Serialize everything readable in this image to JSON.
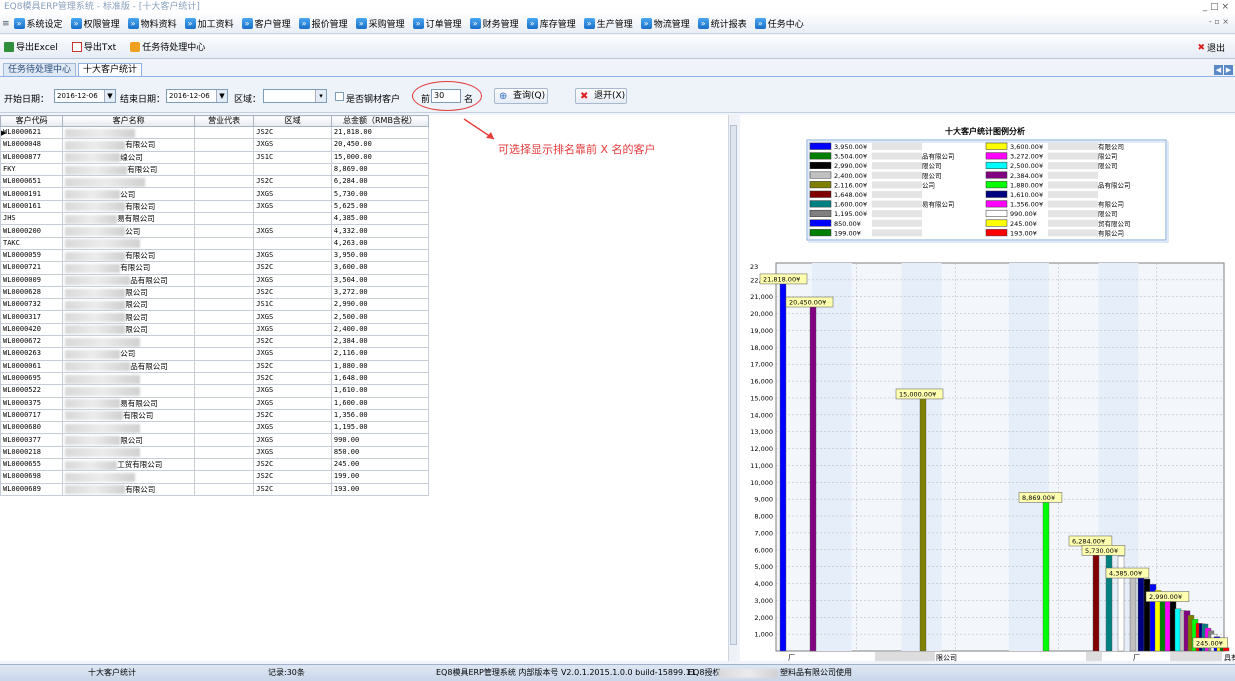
{
  "window": {
    "title": "EQ8模具ERP管理系统 - 标准版 - [十大客户统计]",
    "controls": "_ □ ×"
  },
  "menu": {
    "items": [
      {
        "label": "系统设定"
      },
      {
        "label": "权限管理"
      },
      {
        "label": "物料资料"
      },
      {
        "label": "加工资料"
      },
      {
        "label": "客户管理"
      },
      {
        "label": "报价管理"
      },
      {
        "label": "采购管理"
      },
      {
        "label": "订单管理"
      },
      {
        "label": "财务管理"
      },
      {
        "label": "库存管理"
      },
      {
        "label": "生产管理"
      },
      {
        "label": "物流管理"
      },
      {
        "label": "统计报表"
      },
      {
        "label": "任务中心"
      }
    ],
    "mdi_controls": "- ▫ ×"
  },
  "toolbar": {
    "export_excel": "导出Excel",
    "export_txt": "导出Txt",
    "task_center": "任务待处理中心",
    "exit": "退出"
  },
  "tabs": [
    {
      "label": "任务待处理中心"
    },
    {
      "label": "十大客户统计"
    }
  ],
  "filter": {
    "start_label": "开始日期：",
    "start_value": "2016-12-06",
    "end_label": "结束日期：",
    "end_value": "2016-12-06",
    "region_label": "区域：",
    "region_value": "",
    "steel_label": "是否钢材客户",
    "top_prefix": "前",
    "top_value": "30",
    "top_suffix": "名",
    "query_button": "查询(Q)",
    "exit_button": "退开(X)"
  },
  "annotation": "可选择显示排名靠前 X 名的客户",
  "grid": {
    "columns": [
      "客户代码",
      "客户名称",
      "营业代表",
      "区域",
      "总金额（RMB含税）"
    ],
    "rows": [
      {
        "code": "WL0000621",
        "name": "",
        "rep": "",
        "region": "JS2C",
        "amount": "21,818.00"
      },
      {
        "code": "WL0000048",
        "name": "有限公司",
        "rep": "",
        "region": "JXGS",
        "amount": "20,450.00"
      },
      {
        "code": "WL0000877",
        "name": "缐公司",
        "rep": "",
        "region": "JS1C",
        "amount": "15,000.00"
      },
      {
        "code": "FKY",
        "name": "有限公司",
        "rep": "",
        "region": "",
        "amount": "8,869.00"
      },
      {
        "code": "WL0000651",
        "name": "",
        "rep": "",
        "region": "JS2C",
        "amount": "6,284.00"
      },
      {
        "code": "WL0000191",
        "name": "公司",
        "rep": "",
        "region": "JXGS",
        "amount": "5,730.00"
      },
      {
        "code": "WL0000161",
        "name": "有限公司",
        "rep": "",
        "region": "JXGS",
        "amount": "5,625.00"
      },
      {
        "code": "JHS",
        "name": "易有限公司",
        "rep": "",
        "region": "",
        "amount": "4,385.00"
      },
      {
        "code": "WL0000200",
        "name": "公司",
        "rep": "",
        "region": "JXGS",
        "amount": "4,332.00"
      },
      {
        "code": "TAKC",
        "name": "",
        "rep": "",
        "region": "",
        "amount": "4,263.00"
      },
      {
        "code": "WL0000059",
        "name": "有限公司",
        "rep": "",
        "region": "JXGS",
        "amount": "3,950.00"
      },
      {
        "code": "WL0000721",
        "name": "有限公司",
        "rep": "",
        "region": "JS2C",
        "amount": "3,600.00"
      },
      {
        "code": "WL0000009",
        "name": "品有限公司",
        "rep": "",
        "region": "JXGS",
        "amount": "3,504.00"
      },
      {
        "code": "WL0000628",
        "name": "限公司",
        "rep": "",
        "region": "JS2C",
        "amount": "3,272.00"
      },
      {
        "code": "WL0000732",
        "name": "限公司",
        "rep": "",
        "region": "JS1C",
        "amount": "2,990.00"
      },
      {
        "code": "WL0000317",
        "name": "限公司",
        "rep": "",
        "region": "JXGS",
        "amount": "2,500.00"
      },
      {
        "code": "WL0000420",
        "name": "限公司",
        "rep": "",
        "region": "JXGS",
        "amount": "2,400.00"
      },
      {
        "code": "WL0000672",
        "name": "",
        "rep": "",
        "region": "JS2C",
        "amount": "2,384.00"
      },
      {
        "code": "WL0000263",
        "name": "公司",
        "rep": "",
        "region": "JXGS",
        "amount": "2,116.00"
      },
      {
        "code": "WL0000061",
        "name": "品有限公司",
        "rep": "",
        "region": "JS2C",
        "amount": "1,880.00"
      },
      {
        "code": "WL0000695",
        "name": "",
        "rep": "",
        "region": "JS2C",
        "amount": "1,648.00"
      },
      {
        "code": "WL0000522",
        "name": "",
        "rep": "",
        "region": "JXGS",
        "amount": "1,610.00"
      },
      {
        "code": "WL0000375",
        "name": "易有限公司",
        "rep": "",
        "region": "JXGS",
        "amount": "1,600.00"
      },
      {
        "code": "WL0000717",
        "name": "有限公司",
        "rep": "",
        "region": "JS2C",
        "amount": "1,356.00"
      },
      {
        "code": "WL0000680",
        "name": "",
        "rep": "",
        "region": "JXGS",
        "amount": "1,195.00"
      },
      {
        "code": "WL0000377",
        "name": "限公司",
        "rep": "",
        "region": "JXGS",
        "amount": "990.00"
      },
      {
        "code": "WL0000218",
        "name": "",
        "rep": "",
        "region": "JXGS",
        "amount": "850.00"
      },
      {
        "code": "WL0000655",
        "name": "工贸有限公司",
        "rep": "",
        "region": "JS2C",
        "amount": "245.00"
      },
      {
        "code": "WL0000698",
        "name": "",
        "rep": "",
        "region": "JS2C",
        "amount": "199.00"
      },
      {
        "code": "WL0000689",
        "name": "有限公司",
        "rep": "",
        "region": "JS2C",
        "amount": "193.00"
      }
    ]
  },
  "chart_data": {
    "type": "bar",
    "title": "十大客户统计图例分析",
    "ylim": [
      0,
      23000
    ],
    "yticks": [
      1000,
      2000,
      3000,
      4000,
      5000,
      6000,
      7000,
      8000,
      9000,
      10000,
      11000,
      12000,
      13000,
      14000,
      15000,
      16000,
      17000,
      18000,
      19000,
      20000,
      21000,
      22000
    ],
    "ytick_labels": [
      "1,000",
      "2,000",
      "3,000",
      "4,000",
      "5,000",
      "6,000",
      "7,000",
      "8,000",
      "9,000",
      "10,000",
      "11,000",
      "12,000",
      "13,000",
      "14,000",
      "15,000",
      "16,000",
      "17,000",
      "18,000",
      "19,000",
      "20,000",
      "21,000",
      "22,000"
    ],
    "top_tick_label": "23",
    "values": [
      21818,
      20450,
      15000,
      8869,
      6284,
      5730,
      5625,
      4385,
      4332,
      4263,
      3950,
      3600,
      3504,
      3272,
      2990,
      2500,
      2400,
      2384,
      2116,
      1880,
      1648,
      1610,
      1600,
      1356,
      1195,
      990,
      850,
      245,
      199,
      193
    ],
    "colors": [
      "#0000ff",
      "#800080",
      "#808000",
      "#00ff00",
      "#800000",
      "#008080",
      "#ffffff",
      "#c0c0c0",
      "#000080",
      "#000000",
      "#0000ff",
      "#ffff00",
      "#008000",
      "#ff00ff",
      "#000000",
      "#00ffff",
      "#c0c0c0",
      "#800080",
      "#808000",
      "#00ff00",
      "#ff0000",
      "#000080",
      "#008080",
      "#ff00ff",
      "#808080",
      "#ffffff",
      "#0000ff",
      "#ffff00",
      "#008000",
      "#ff0000"
    ],
    "data_labels": [
      "21,818.00¥",
      "20,450.00¥",
      "15,000.00¥",
      "8,869.00¥",
      "6,284.00¥",
      "5,730.00¥",
      "",
      "4,385.00¥",
      "",
      "",
      "",
      "",
      "",
      "",
      "2,990.00¥",
      "",
      "",
      "",
      "",
      "",
      "",
      "",
      "",
      "",
      "",
      "",
      "",
      "245.00¥",
      "",
      ""
    ],
    "legend": [
      {
        "value": "3,950.00¥",
        "color": "#0000ff",
        "name": ""
      },
      {
        "value": "3,600.00¥",
        "color": "#ffff00",
        "name": "有限公司"
      },
      {
        "value": "3,504.00¥",
        "color": "#008000",
        "name": "品有限公司"
      },
      {
        "value": "3,272.00¥",
        "color": "#ff00ff",
        "name": "限公司"
      },
      {
        "value": "2,990.00¥",
        "color": "#000000",
        "name": "限公司"
      },
      {
        "value": "2,500.00¥",
        "color": "#00ffff",
        "name": "限公司"
      },
      {
        "value": "2,400.00¥",
        "color": "#c0c0c0",
        "name": "限公司"
      },
      {
        "value": "2,384.00¥",
        "color": "#800080",
        "name": ""
      },
      {
        "value": "2,116.00¥",
        "color": "#808000",
        "name": "公司"
      },
      {
        "value": "1,880.00¥",
        "color": "#00ff00",
        "name": "品有限公司"
      },
      {
        "value": "1,648.00¥",
        "color": "#800000",
        "name": ""
      },
      {
        "value": "1,610.00¥",
        "color": "#000080",
        "name": ""
      },
      {
        "value": "1,600.00¥",
        "color": "#008080",
        "name": "易有限公司"
      },
      {
        "value": "1,356.00¥",
        "color": "#ff00ff",
        "name": "有限公司"
      },
      {
        "value": "1,195.00¥",
        "color": "#808080",
        "name": ""
      },
      {
        "value": "990.00¥",
        "color": "#ffffff",
        "name": "限公司"
      },
      {
        "value": "850.00¥",
        "color": "#0000ff",
        "name": ""
      },
      {
        "value": "245.00¥",
        "color": "#ffff00",
        "name": "贸有限公司"
      },
      {
        "value": "199.00¥",
        "color": "#008000",
        "name": ""
      },
      {
        "value": "193.00¥",
        "color": "#ff0000",
        "name": "有限公司"
      }
    ],
    "x_labels": [
      "厂",
      "限公司",
      "厂",
      "具有"
    ]
  },
  "status": {
    "title": "十大客户统计",
    "records": "记录:30条",
    "version": "EQ8模具ERP管理系统 内部版本号 V2.0.1.2015.1.0.0 build-15899.11",
    "license": "EQ8授权",
    "license_to": "塑料品有限公司使用"
  }
}
